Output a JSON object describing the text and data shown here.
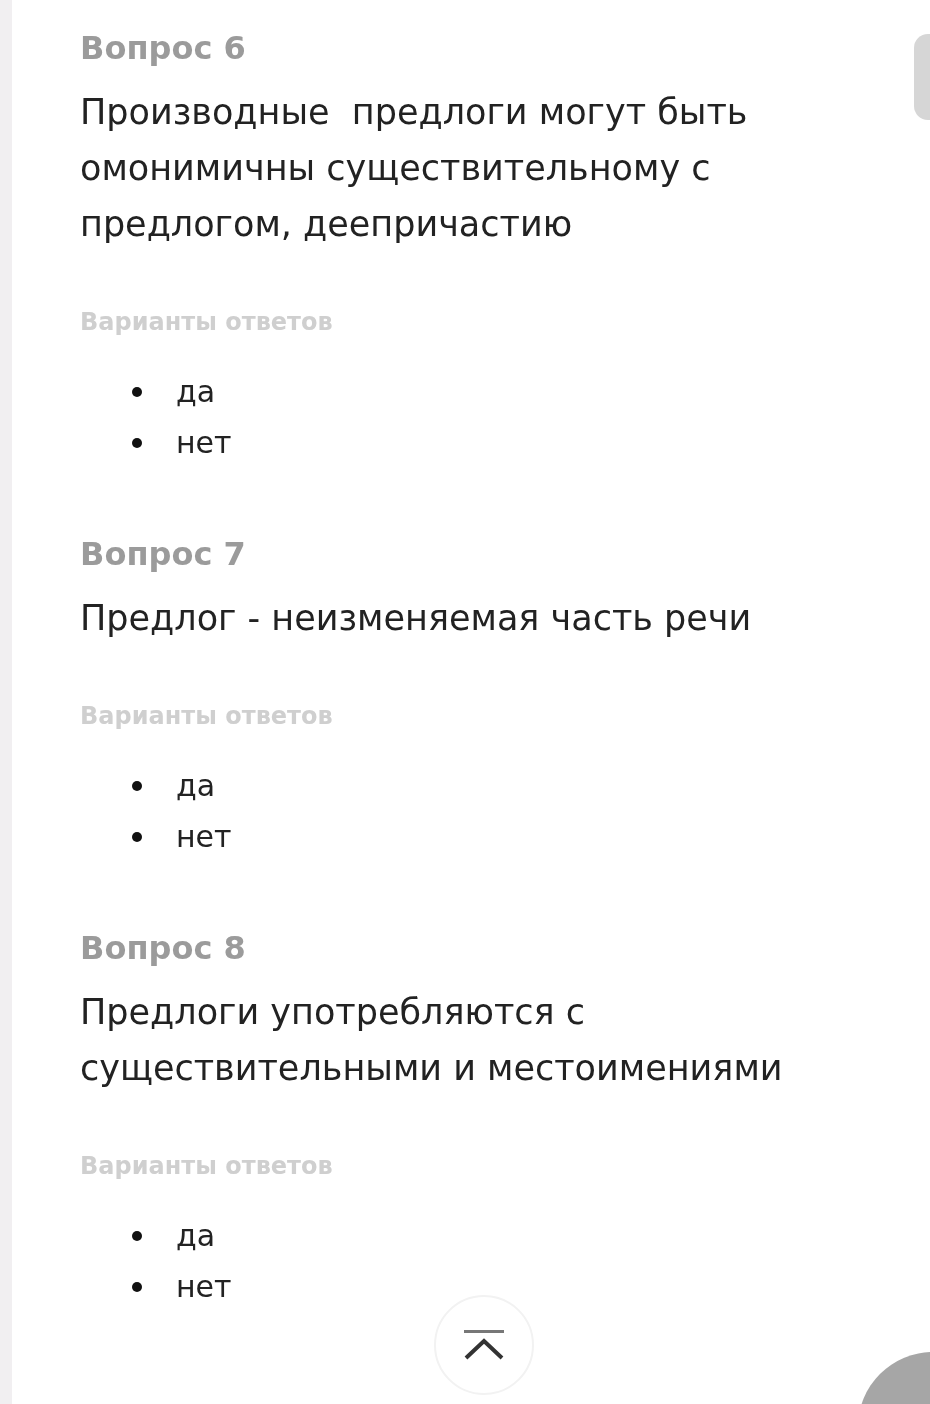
{
  "questions": [
    {
      "heading": "Вопрос 6",
      "text": "Производные  предлоги могут быть омонимичны существительному с предлогом, деепричастию",
      "options_label": "Варианты ответов",
      "options": [
        "да",
        "нет"
      ]
    },
    {
      "heading": "Вопрос 7",
      "text": "Предлог - неизменяемая часть речи",
      "options_label": "Варианты ответов",
      "options": [
        "да",
        "нет"
      ]
    },
    {
      "heading": "Вопрос 8",
      "text": "Предлоги употребляются с существительными и местоимениями",
      "options_label": "Варианты ответов",
      "options": [
        "да",
        "нет"
      ]
    }
  ]
}
